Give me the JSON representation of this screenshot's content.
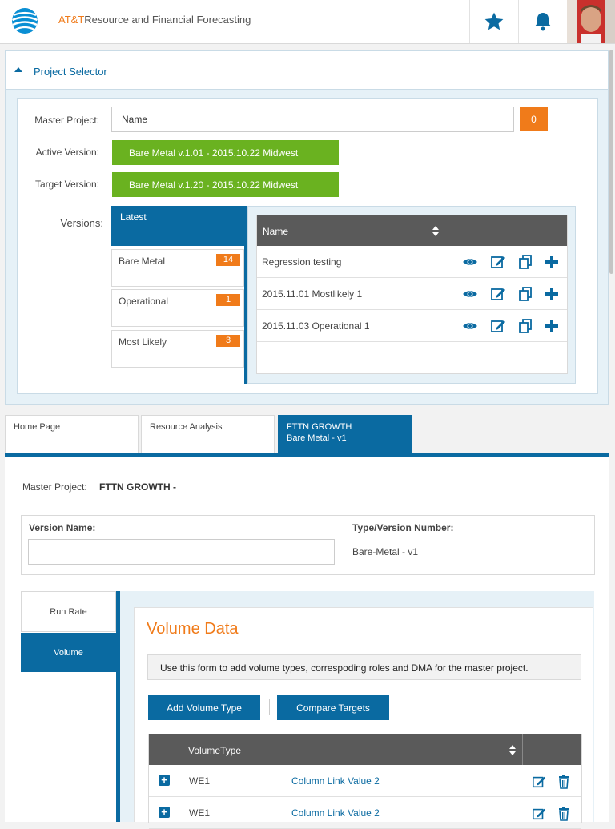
{
  "header": {
    "brand": "AT&T",
    "title": "Resource and Financial Forecasting",
    "favorites_icon": "star-icon",
    "notifications_icon": "bell-icon"
  },
  "project_selector": {
    "title": "Project Selector",
    "master_project_label": "Master Project:",
    "master_project_value": "Name",
    "master_project_count": "0",
    "active_version_label": "Active Version:",
    "active_version_value": "Bare Metal v.1.01 - 2015.10.22 Midwest",
    "target_version_label": "Target Version:",
    "target_version_value": "Bare Metal v.1.20 - 2015.10.22 Midwest",
    "versions_label": "Versions:",
    "latest_label": "Latest",
    "version_groups": [
      {
        "label": "Bare Metal",
        "count": "14"
      },
      {
        "label": "Operational",
        "count": "1"
      },
      {
        "label": "Most Likely",
        "count": "3"
      }
    ],
    "table_header": "Name",
    "rows": [
      {
        "name": "Regression testing"
      },
      {
        "name": "2015.11.01 Mostlikely 1"
      },
      {
        "name": "2015.11.03 Operational 1"
      },
      {
        "name": ""
      }
    ]
  },
  "tabs": [
    {
      "label": "Home Page",
      "sub": ""
    },
    {
      "label": "Resource Analysis",
      "sub": ""
    },
    {
      "label": "FTTN GROWTH",
      "sub": "Bare Metal - v1"
    }
  ],
  "main": {
    "master_project_label": "Master Project:",
    "master_project_value": "FTTN GROWTH -",
    "version_name_label": "Version Name:",
    "version_name_value": "",
    "type_version_label": "Type/Version Number:",
    "type_version_value": "Bare-Metal - v1",
    "side_nav": [
      "Run Rate",
      "Volume"
    ],
    "volume": {
      "title": "Volume Data",
      "info": "Use this form to add volume types, correspoding roles and DMA for the master project.",
      "add_button": "Add Volume Type",
      "compare_button": "Compare Targets",
      "table_header": "VolumeType",
      "rows": [
        {
          "type": "WE1",
          "link": "Column Link Value 2"
        },
        {
          "type": "WE1",
          "link": "Column Link Value 2"
        }
      ]
    }
  },
  "colors": {
    "primary": "#0a6aa1",
    "accent": "#f07b1a",
    "green": "#6ab220"
  }
}
